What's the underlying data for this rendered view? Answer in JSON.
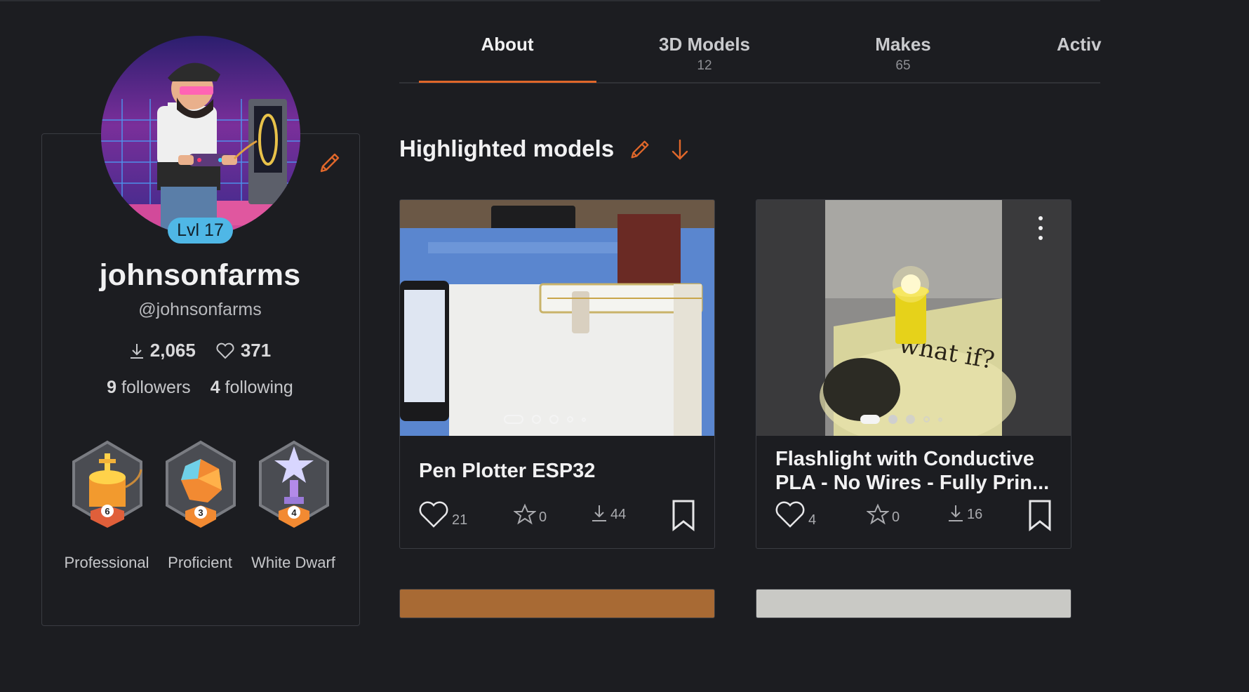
{
  "profile": {
    "level": "Lvl 17",
    "display_name": "johnsonfarms",
    "handle": "@johnsonfarms",
    "downloads": "2,065",
    "likes": "371",
    "followers_count": "9",
    "followers_label": "followers",
    "following_count": "4",
    "following_label": "following",
    "badges": [
      {
        "label": "Professional",
        "rank": "6"
      },
      {
        "label": "Proficient",
        "rank": "3"
      },
      {
        "label": "White Dwarf",
        "rank": "4"
      }
    ]
  },
  "tabs": [
    {
      "label": "About",
      "count": ""
    },
    {
      "label": "3D Models",
      "count": "12"
    },
    {
      "label": "Makes",
      "count": "65"
    },
    {
      "label": "Activ",
      "count": ""
    }
  ],
  "highlighted": {
    "title": "Highlighted models"
  },
  "cards": [
    {
      "title": "Pen Plotter ESP32",
      "likes": "21",
      "rating": "0",
      "downloads": "44"
    },
    {
      "title": "Flashlight with Conductive PLA - No Wires - Fully Prin...",
      "likes": "4",
      "rating": "0",
      "downloads": "16"
    }
  ],
  "colors": {
    "accent": "#e0672a",
    "level_badge": "#4fb7e6",
    "background": "#1c1d21"
  }
}
